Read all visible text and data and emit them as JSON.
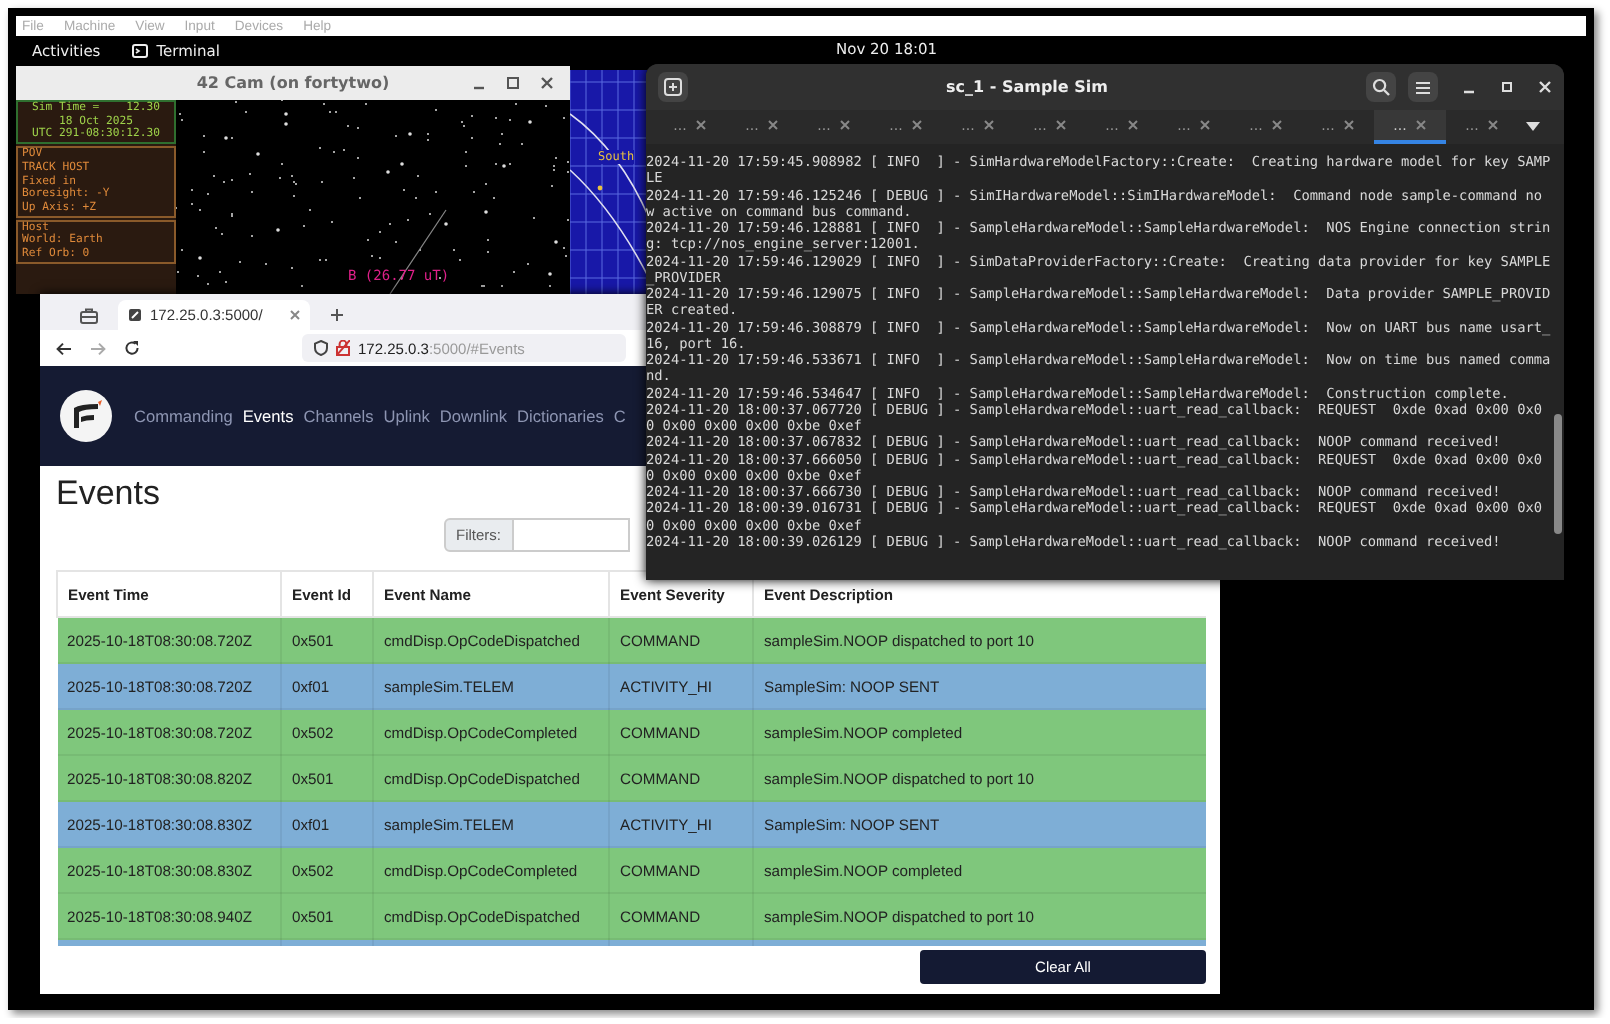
{
  "vm_menu": [
    "File",
    "Machine",
    "View",
    "Input",
    "Devices",
    "Help"
  ],
  "top_bar": {
    "activities": "Activities",
    "app": "Terminal",
    "clock": "Nov 20 18:01"
  },
  "cam_window": {
    "title": "42 Cam (on fortytwo)",
    "time_box": [
      "Sim Time =    12.30",
      "18 Oct 2025",
      "UTC 291-08:30:12.30"
    ],
    "pov_box": [
      "POV",
      "TRACK HOST",
      "Fixed in",
      "Boresight: -Y",
      "Up Axis: +Z"
    ],
    "host_box": [
      "Host",
      "World: Earth",
      "Ref Orb: 0"
    ],
    "field_label": "B (26.77 uT)"
  },
  "map_window": {
    "label": "South"
  },
  "terminal": {
    "title": "sc_1 - Sample Sim",
    "tabs": [
      {
        "label": "...",
        "selected": false
      },
      {
        "label": "...",
        "selected": false
      },
      {
        "label": "...",
        "selected": false
      },
      {
        "label": "...",
        "selected": false
      },
      {
        "label": "...",
        "selected": false
      },
      {
        "label": "...",
        "selected": false
      },
      {
        "label": "...",
        "selected": false
      },
      {
        "label": "...",
        "selected": false
      },
      {
        "label": "...",
        "selected": false
      },
      {
        "label": "...",
        "selected": false
      },
      {
        "label": "...",
        "selected": true
      },
      {
        "label": "...",
        "selected": false
      }
    ],
    "log": [
      "2024-11-20 17:59:45.908982 [ INFO  ] - SimHardwareModelFactory::Create:  Creating hardware model for key SAMPLE",
      "2024-11-20 17:59:46.125246 [ DEBUG ] - SimIHardwareModel::SimIHardwareModel:  Command node sample-command now active on command bus command.",
      "2024-11-20 17:59:46.128881 [ INFO  ] - SampleHardwareModel::SampleHardwareModel:  NOS Engine connection string: tcp://nos_engine_server:12001.",
      "2024-11-20 17:59:46.129029 [ INFO  ] - SimDataProviderFactory::Create:  Creating data provider for key SAMPLE_PROVIDER",
      "2024-11-20 17:59:46.129075 [ INFO  ] - SampleHardwareModel::SampleHardwareModel:  Data provider SAMPLE_PROVIDER created.",
      "2024-11-20 17:59:46.308879 [ INFO  ] - SampleHardwareModel::SampleHardwareModel:  Now on UART bus name usart_16, port 16.",
      "2024-11-20 17:59:46.533671 [ INFO  ] - SampleHardwareModel::SampleHardwareModel:  Now on time bus named command.",
      "2024-11-20 17:59:46.534647 [ INFO  ] - SampleHardwareModel::SampleHardwareModel:  Construction complete.",
      "2024-11-20 18:00:37.067720 [ DEBUG ] - SampleHardwareModel::uart_read_callback:  REQUEST  0xde 0xad 0x00 0x00 0x00 0x00 0x00 0xbe 0xef",
      "2024-11-20 18:00:37.067832 [ DEBUG ] - SampleHardwareModel::uart_read_callback:  NOOP command received!",
      "2024-11-20 18:00:37.666050 [ DEBUG ] - SampleHardwareModel::uart_read_callback:  REQUEST  0xde 0xad 0x00 0x00 0x00 0x00 0x00 0xbe 0xef",
      "2024-11-20 18:00:37.666730 [ DEBUG ] - SampleHardwareModel::uart_read_callback:  NOOP command received!",
      "2024-11-20 18:00:39.016731 [ DEBUG ] - SampleHardwareModel::uart_read_callback:  REQUEST  0xde 0xad 0x00 0x00 0x00 0x00 0x00 0xbe 0xef",
      "2024-11-20 18:00:39.026129 [ DEBUG ] - SampleHardwareModel::uart_read_callback:  NOOP command received!"
    ]
  },
  "browser": {
    "tab_title": "172.25.0.3:5000/",
    "url_host": "172.25.0.3",
    "url_rest": ":5000/#Events",
    "nav": [
      {
        "label": "Commanding",
        "selected": false
      },
      {
        "label": "Events",
        "selected": true
      },
      {
        "label": "Channels",
        "selected": false
      },
      {
        "label": "Uplink",
        "selected": false
      },
      {
        "label": "Downlink",
        "selected": false
      },
      {
        "label": "Dictionaries",
        "selected": false
      },
      {
        "label": "C",
        "selected": false
      }
    ],
    "heading": "Events",
    "filter": {
      "label": "Filters:"
    },
    "table": {
      "columns": [
        "Event Time",
        "Event Id",
        "Event Name",
        "Event Severity",
        "Event Description"
      ],
      "rows": [
        {
          "color": "#7fc77c",
          "cells": [
            "2025-10-18T08:30:08.720Z",
            "0x501",
            "cmdDisp.OpCodeDispatched",
            "COMMAND",
            "sampleSim.NOOP dispatched to port 10"
          ]
        },
        {
          "color": "#7eaed6",
          "cells": [
            "2025-10-18T08:30:08.720Z",
            "0xf01",
            "sampleSim.TELEM",
            "ACTIVITY_HI",
            "SampleSim: NOOP SENT"
          ]
        },
        {
          "color": "#7fc77c",
          "cells": [
            "2025-10-18T08:30:08.720Z",
            "0x502",
            "cmdDisp.OpCodeCompleted",
            "COMMAND",
            "sampleSim.NOOP completed"
          ]
        },
        {
          "color": "#7fc77c",
          "cells": [
            "2025-10-18T08:30:08.820Z",
            "0x501",
            "cmdDisp.OpCodeDispatched",
            "COMMAND",
            "sampleSim.NOOP dispatched to port 10"
          ]
        },
        {
          "color": "#7eaed6",
          "cells": [
            "2025-10-18T08:30:08.830Z",
            "0xf01",
            "sampleSim.TELEM",
            "ACTIVITY_HI",
            "SampleSim: NOOP SENT"
          ]
        },
        {
          "color": "#7fc77c",
          "cells": [
            "2025-10-18T08:30:08.830Z",
            "0x502",
            "cmdDisp.OpCodeCompleted",
            "COMMAND",
            "sampleSim.NOOP completed"
          ]
        },
        {
          "color": "#7fc77c",
          "cells": [
            "2025-10-18T08:30:08.940Z",
            "0x501",
            "cmdDisp.OpCodeDispatched",
            "COMMAND",
            "sampleSim.NOOP dispatched to port 10"
          ]
        },
        {
          "color": "#7eaed6",
          "cells": []
        }
      ]
    },
    "clear_button": "Clear All"
  }
}
